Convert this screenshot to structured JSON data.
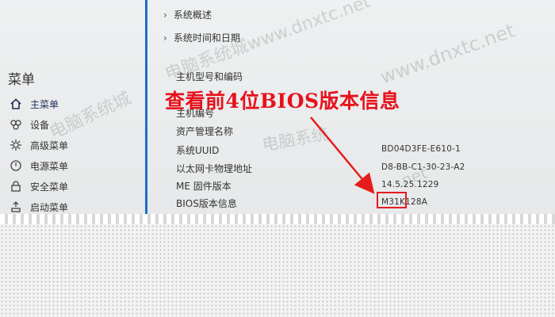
{
  "sidebar": {
    "title": "菜单",
    "items": [
      {
        "label": "主菜单",
        "icon": "home-icon"
      },
      {
        "label": "设备",
        "icon": "devices-icon"
      },
      {
        "label": "高级菜单",
        "icon": "advanced-gear-icon"
      },
      {
        "label": "电源菜单",
        "icon": "power-icon"
      },
      {
        "label": "安全菜单",
        "icon": "security-lock-icon"
      },
      {
        "label": "启动菜单",
        "icon": "boot-icon"
      }
    ]
  },
  "main": {
    "nav_links": [
      {
        "label": "系统概述"
      },
      {
        "label": "系统时间和日期"
      }
    ],
    "rows": [
      {
        "label": "主机型号和编码",
        "value": ""
      },
      {
        "label": "主机编号",
        "value": ""
      },
      {
        "label": "资产管理名称",
        "value": ""
      },
      {
        "label": "系统UUID",
        "value": "BD04D3FE-E610-1"
      },
      {
        "label": "以太网卡物理地址",
        "value": "D8-BB-C1-30-23-A2"
      },
      {
        "label": "ME 固件版本",
        "value": "14.5.25.1229"
      },
      {
        "label": "BIOS版本信息",
        "value": "M31K128A"
      }
    ]
  },
  "annotation": {
    "text": "查看前4位BIOS版本信息",
    "color": "#e8111a"
  },
  "watermarks": [
    "电脑系统城www.dnxtc.net",
    "www.dnxtc.net",
    "电脑系统城",
    "电脑系统",
    ".net"
  ],
  "colors": {
    "divider": "#1d6ec5",
    "highlight": "#e61b1b"
  }
}
